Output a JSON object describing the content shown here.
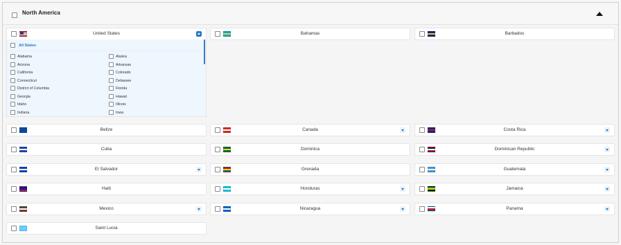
{
  "region": {
    "title": "North America"
  },
  "us": {
    "name": "United States",
    "all_label": "All States",
    "states": [
      "Alabama",
      "Alaska",
      "Arizona",
      "Arkansas",
      "California",
      "Colorado",
      "Connecticut",
      "Delaware",
      "District of Columbia",
      "Florida",
      "Georgia",
      "Hawaii",
      "Idaho",
      "Illinois",
      "Indiana",
      "Iowa"
    ]
  },
  "countries": [
    {
      "name": "Bahamas",
      "flag": [
        "#00a9c6",
        "#f5d33b",
        "#00a9c6"
      ]
    },
    {
      "name": "Barbados",
      "flag": [
        "#00267f",
        "#ffc726",
        "#00267f"
      ]
    },
    {
      "name": "Belize",
      "flag": [
        "#0a4aa0",
        "#0a4aa0",
        "#0a4aa0"
      ]
    },
    {
      "name": "Canada",
      "flag": [
        "#d52b1e",
        "#ffffff",
        "#d52b1e"
      ]
    },
    {
      "name": "Costa Rica",
      "flag": [
        "#002b7f",
        "#ce1126",
        "#002b7f"
      ]
    },
    {
      "name": "Cuba",
      "flag": [
        "#2448a5",
        "#ffffff",
        "#2448a5"
      ]
    },
    {
      "name": "Dominica",
      "flag": [
        "#006b3f",
        "#f9d616",
        "#006b3f"
      ]
    },
    {
      "name": "Dominican Republic",
      "flag": [
        "#002d62",
        "#ffffff",
        "#ce1126"
      ]
    },
    {
      "name": "El Salvador",
      "flag": [
        "#0f47af",
        "#ffffff",
        "#0f47af"
      ]
    },
    {
      "name": "Grenada",
      "flag": [
        "#ce1126",
        "#fcd116",
        "#007a5e"
      ]
    },
    {
      "name": "Guatemala",
      "flag": [
        "#4997d0",
        "#ffffff",
        "#4997d0"
      ]
    },
    {
      "name": "Haiti",
      "flag": [
        "#00209f",
        "#00209f",
        "#d21034"
      ]
    },
    {
      "name": "Honduras",
      "flag": [
        "#18c3df",
        "#ffffff",
        "#18c3df"
      ]
    },
    {
      "name": "Jamaica",
      "flag": [
        "#009b3a",
        "#fed100",
        "#000000"
      ]
    },
    {
      "name": "Mexico",
      "flag": [
        "#006847",
        "#ffffff",
        "#ce1126"
      ]
    },
    {
      "name": "Nicaragua",
      "flag": [
        "#0067c6",
        "#ffffff",
        "#0067c6"
      ]
    },
    {
      "name": "Panama",
      "flag": [
        "#ffffff",
        "#da121a",
        "#005293"
      ]
    },
    {
      "name": "Saint Lucia",
      "flag": [
        "#65cfff",
        "#65cfff",
        "#65cfff"
      ]
    }
  ],
  "colors": {
    "accent": "#2b75c6",
    "states_bg": "#eef6fe"
  }
}
